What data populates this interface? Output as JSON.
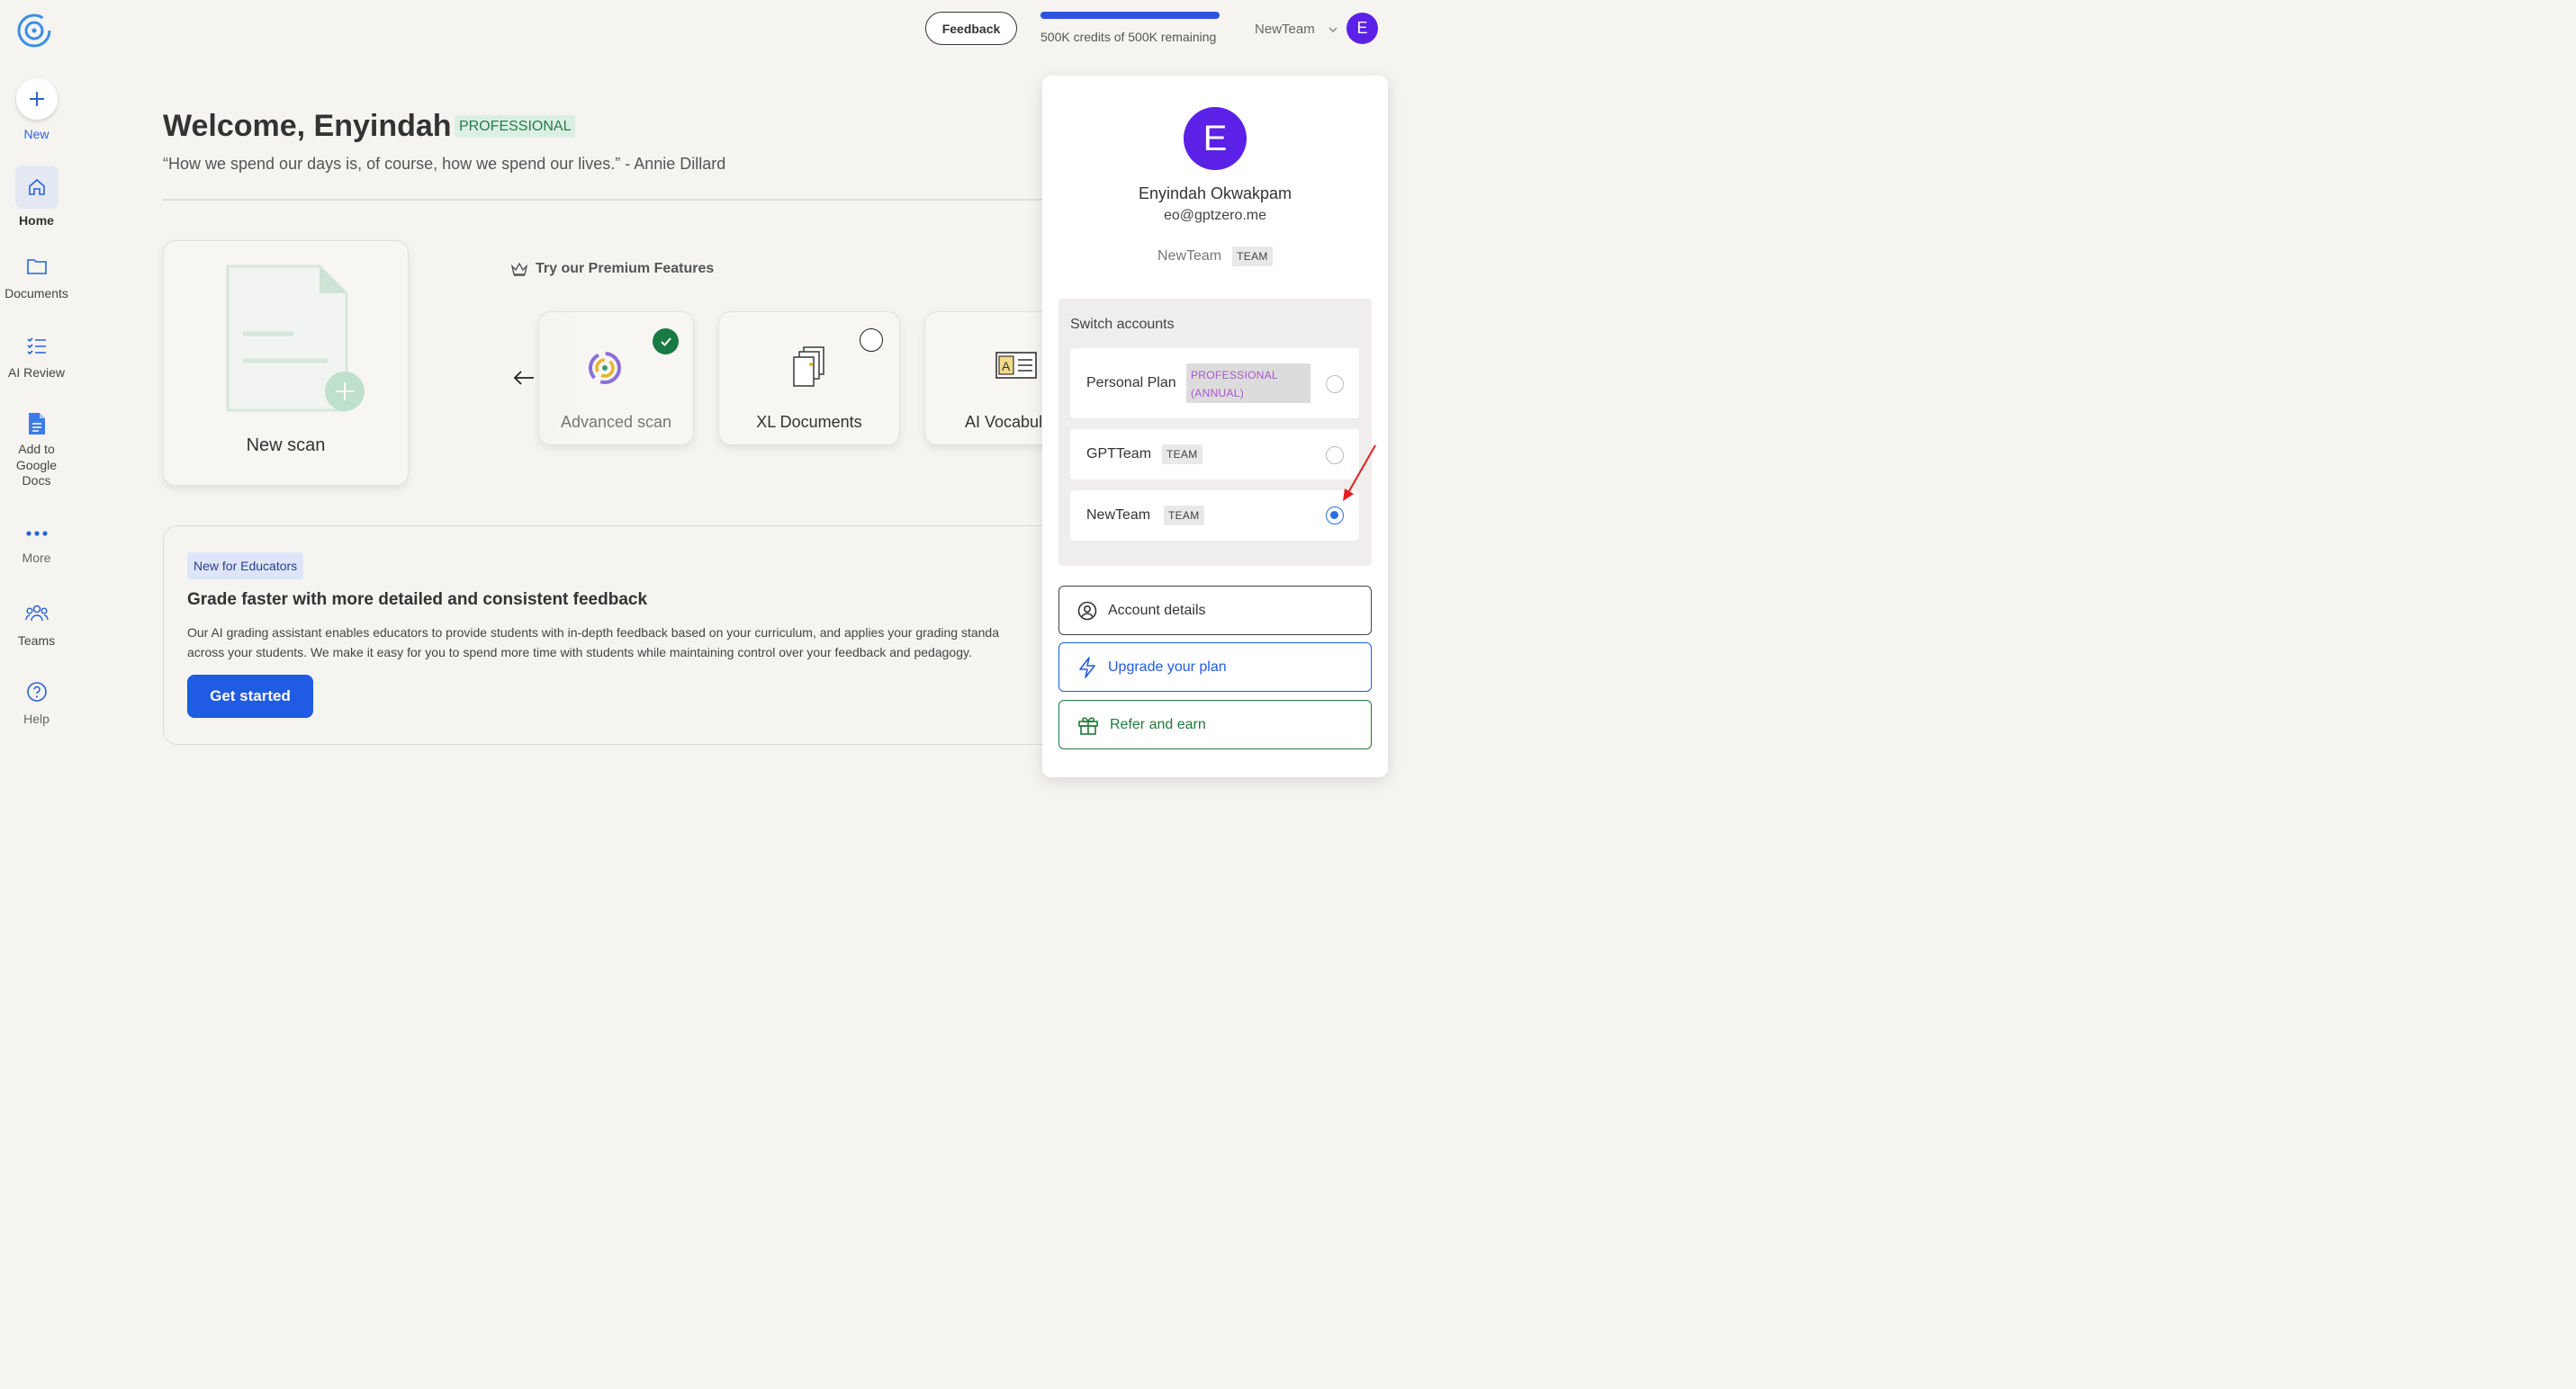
{
  "sidebar": {
    "new_label": "New",
    "items": [
      {
        "label": "Home"
      },
      {
        "label": "Documents"
      },
      {
        "label": "AI Review"
      },
      {
        "label": "Add to Google Docs"
      },
      {
        "label": "More"
      },
      {
        "label": "Teams"
      },
      {
        "label": "Help"
      }
    ]
  },
  "topbar": {
    "feedback_label": "Feedback",
    "credits_text": "500K credits of 500K remaining",
    "credits_fraction": 1.0,
    "team_selector": "NewTeam",
    "avatar_initial": "E"
  },
  "main": {
    "welcome": "Welcome, Enyindah",
    "plan_badge": "PROFESSIONAL",
    "quote": "“How we spend our days is, of course, how we spend our lives.” - Annie Dillard",
    "new_scan_label": "New scan",
    "premium_title": "Try our Premium Features",
    "features": [
      {
        "label": "Advanced scan",
        "checked": true
      },
      {
        "label": "XL Documents",
        "checked": false
      },
      {
        "label": "AI Vocabul",
        "checked": false
      }
    ],
    "educators": {
      "badge": "New for Educators",
      "title": "Grade faster with more detailed and consistent feedback",
      "text_line1": "Our AI grading assistant enables educators to provide students with in-depth feedback based on your curriculum, and applies your grading standa",
      "text_line2": "across your students. We make it easy for you to spend more time with students while maintaining control over your feedback and pedagogy.",
      "button": "Get started"
    }
  },
  "account_panel": {
    "avatar_initial": "E",
    "name": "Enyindah Okwakpam",
    "email": "eo@gptzero.me",
    "team_name": "NewTeam",
    "team_tag": "TEAM",
    "switch_title": "Switch accounts",
    "accounts": [
      {
        "name": "Personal Plan",
        "tag_line1": "PROFESSIONAL",
        "tag_line2": "(ANNUAL)",
        "selected": false
      },
      {
        "name": "GPTTeam",
        "tag": "TEAM",
        "selected": false
      },
      {
        "name": "NewTeam",
        "tag": "TEAM",
        "selected": true
      }
    ],
    "actions": [
      {
        "label": "Account details",
        "color": "#333333"
      },
      {
        "label": "Upgrade your plan",
        "color": "#1f5be3"
      },
      {
        "label": "Refer and earn",
        "color": "#1e7a3a"
      }
    ]
  },
  "colors": {
    "accent": "#1f5be3",
    "avatar": "#5b21e6",
    "annotation_arrow": "#e02020"
  }
}
